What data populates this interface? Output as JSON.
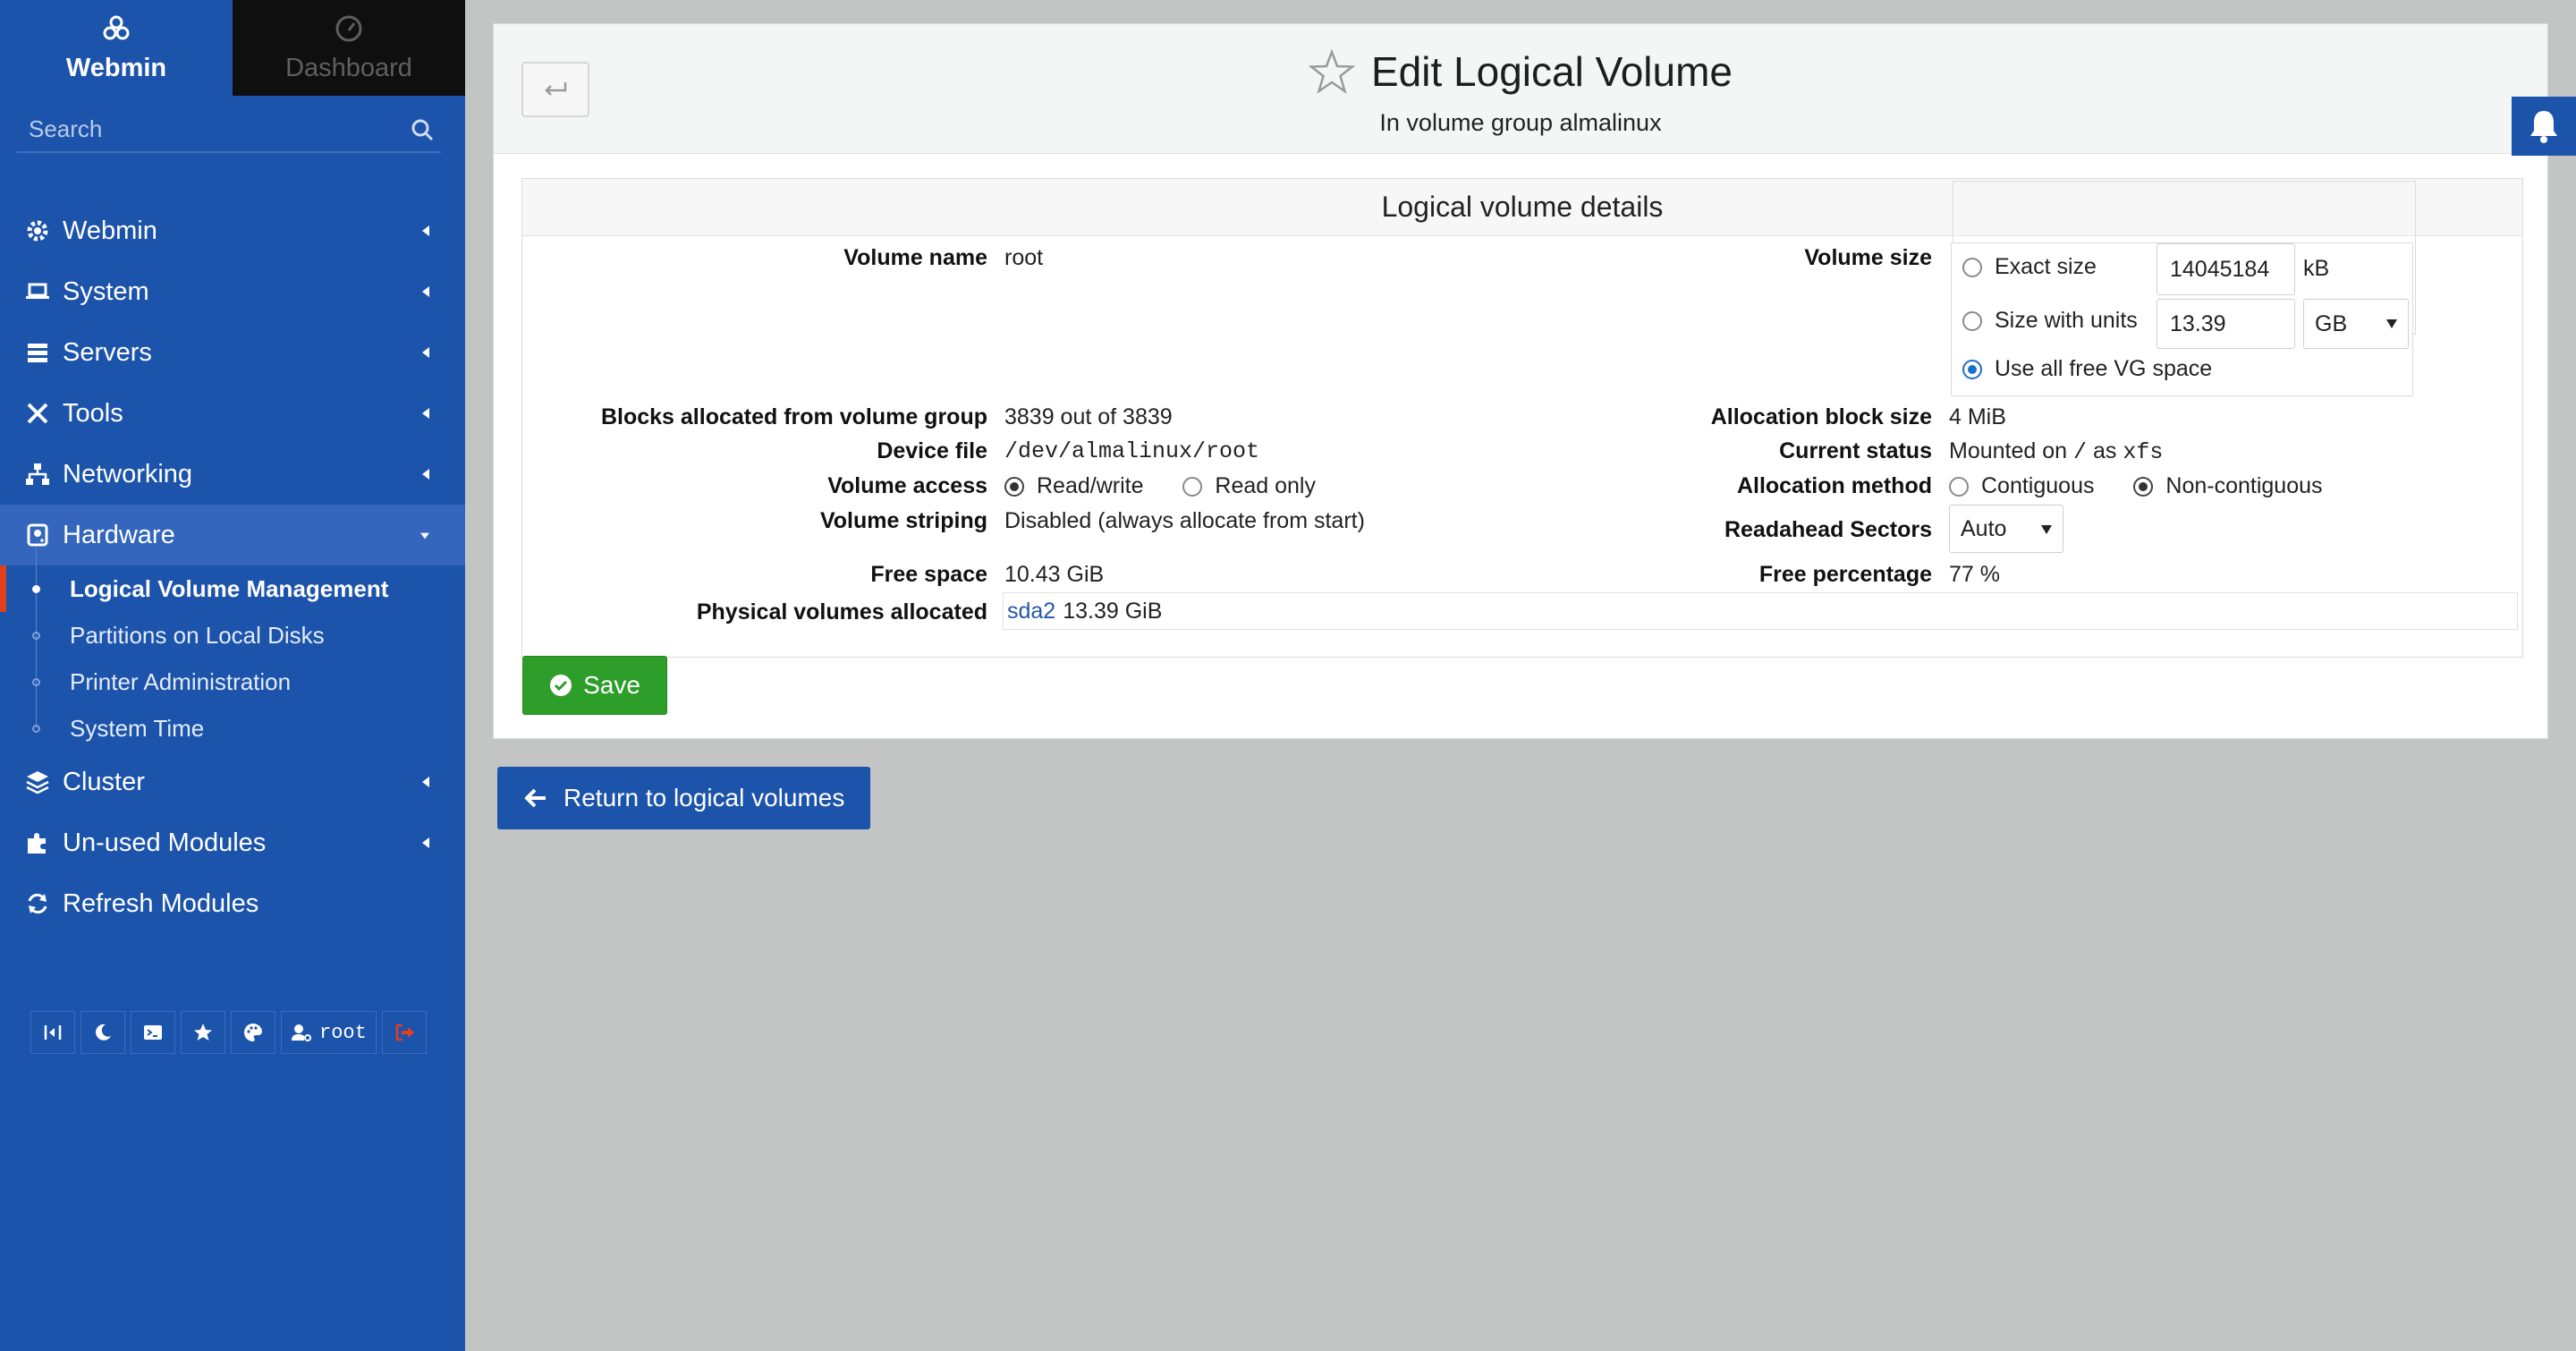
{
  "sidebar": {
    "tabs": [
      {
        "label": "Webmin",
        "icon": "webmin-logo-icon",
        "active": true
      },
      {
        "label": "Dashboard",
        "icon": "dashboard-gauge-icon",
        "active": false
      }
    ],
    "search_placeholder": "Search",
    "menu": [
      {
        "label": "Webmin",
        "icon": "gear-icon"
      },
      {
        "label": "System",
        "icon": "laptop-icon"
      },
      {
        "label": "Servers",
        "icon": "server-icon"
      },
      {
        "label": "Tools",
        "icon": "tools-icon"
      },
      {
        "label": "Networking",
        "icon": "network-icon"
      },
      {
        "label": "Hardware",
        "icon": "hard-drive-icon",
        "open": true
      },
      {
        "label": "Cluster",
        "icon": "layers-icon"
      },
      {
        "label": "Un-used Modules",
        "icon": "puzzle-icon"
      },
      {
        "label": "Refresh Modules",
        "icon": "refresh-icon"
      }
    ],
    "hardware_items": [
      {
        "label": "Logical Volume Management",
        "active": true
      },
      {
        "label": "Partitions on Local Disks"
      },
      {
        "label": "Printer Administration"
      },
      {
        "label": "System Time"
      }
    ],
    "toolbar": {
      "user": "root"
    }
  },
  "page": {
    "title": "Edit Logical Volume",
    "subtitle": "In volume group almalinux",
    "panel_title": "Logical volume details"
  },
  "form": {
    "volume_name_label": "Volume name",
    "volume_name": "root",
    "volume_size_label": "Volume size",
    "size_options": {
      "exact_label": "Exact size",
      "exact_value": "14045184",
      "exact_unit": "kB",
      "units_label": "Size with units",
      "units_value": "13.39",
      "units_unit": "GB",
      "free_label": "Use all free VG space",
      "selected": "free"
    },
    "blocks_label": "Blocks allocated from volume group",
    "blocks_value": "3839 out of 3839",
    "alloc_block_label": "Allocation block size",
    "alloc_block_value": "4 MiB",
    "device_label": "Device file",
    "device_value": "/dev/almalinux/root",
    "status_label": "Current status",
    "status_prefix": "Mounted on",
    "status_mount": "/",
    "status_mid": "as",
    "status_fs": "xfs",
    "access_label": "Volume access",
    "access_rw": "Read/write",
    "access_ro": "Read only",
    "access_selected": "rw",
    "alloc_method_label": "Allocation method",
    "alloc_contig": "Contiguous",
    "alloc_noncontig": "Non-contiguous",
    "alloc_selected": "noncontig",
    "striping_label": "Volume striping",
    "striping_value": "Disabled (always allocate from start)",
    "readahead_label": "Readahead Sectors",
    "readahead_value": "Auto",
    "free_space_label": "Free space",
    "free_space_value": "10.43 GiB",
    "free_pct_label": "Free percentage",
    "free_pct_value": "77 %",
    "pv_label": "Physical volumes allocated",
    "pv_link": "sda2",
    "pv_size": "13.39 GiB"
  },
  "buttons": {
    "save": "Save",
    "return": "Return to logical volumes"
  },
  "colors": {
    "sidebar": "#1c53ab",
    "save": "#2d9e2a",
    "active_marker": "#e0401c"
  }
}
